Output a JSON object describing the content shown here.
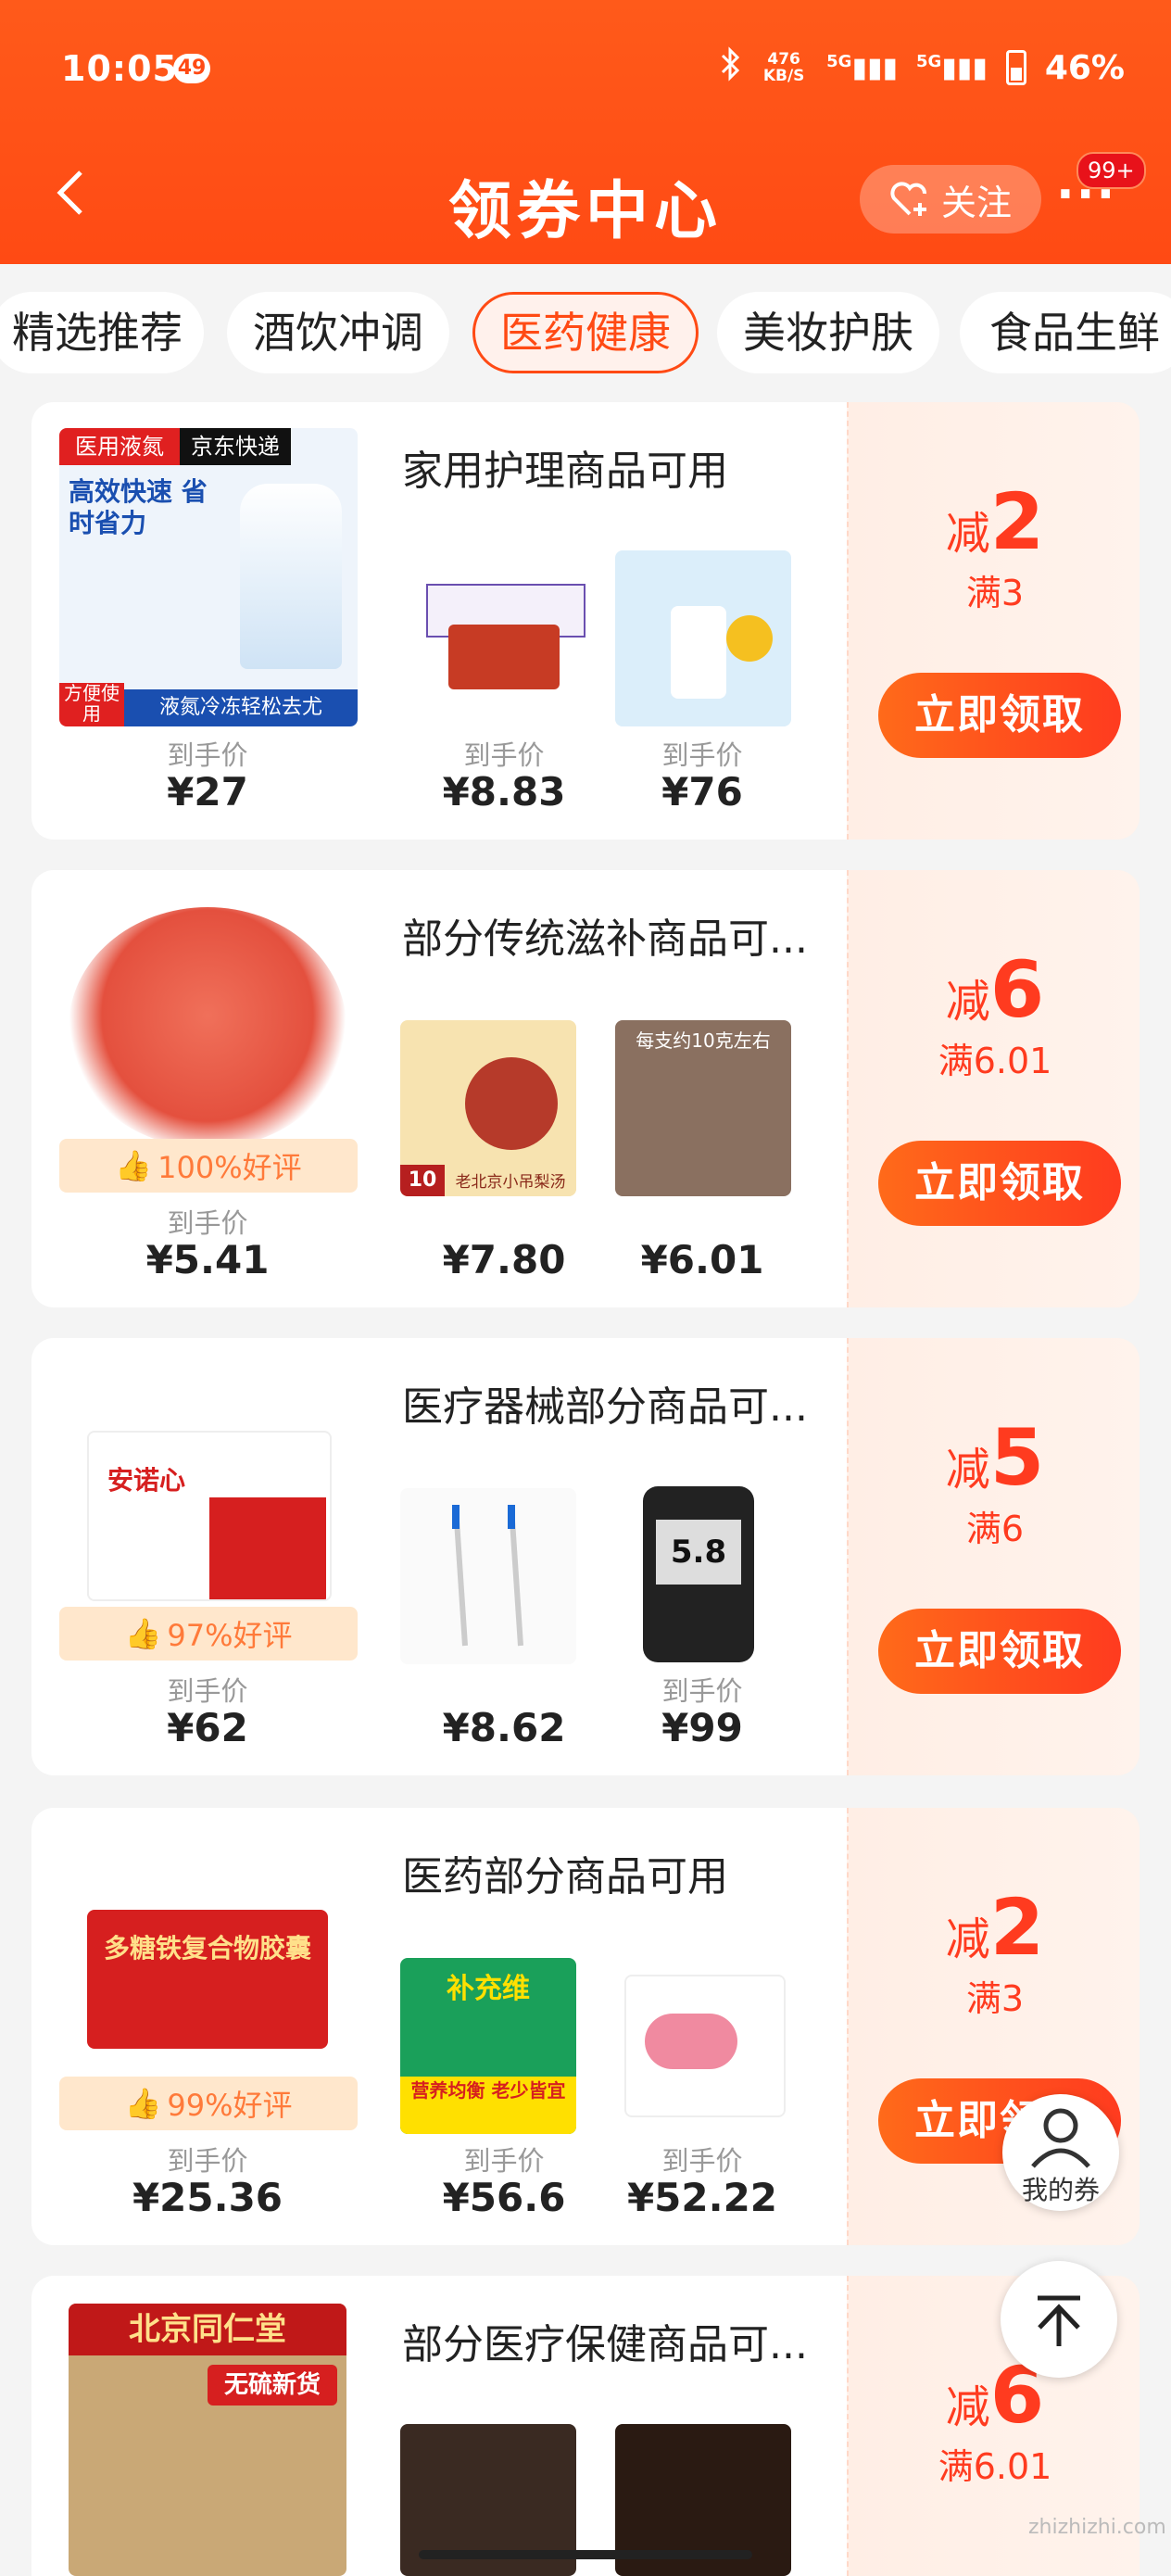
{
  "status_bar": {
    "time": "10:05",
    "notif_count": "49",
    "net_speed": "476 KB/S",
    "signal1": "5G",
    "signal2": "5G",
    "battery": "46%"
  },
  "nav": {
    "title": "领券中心",
    "follow_label": "关注",
    "more": "···",
    "msg_badge": "99+"
  },
  "tabs": [
    {
      "label": "精选推荐",
      "active": false
    },
    {
      "label": "酒饮冲调",
      "active": false
    },
    {
      "label": "医药健康",
      "active": true
    },
    {
      "label": "美妆护肤",
      "active": false
    },
    {
      "label": "食品生鲜",
      "active": false
    }
  ],
  "coupons": [
    {
      "title": "家用护理商品可用",
      "rating": "",
      "products": [
        {
          "label": "到手价",
          "price": "¥27"
        },
        {
          "label": "到手价",
          "price": "¥8.83"
        },
        {
          "label": "到手价",
          "price": "¥76"
        }
      ],
      "thumb_text": {
        "a": "医用液氮",
        "b": "京东快递",
        "c": "高效快速 省时省力",
        "d": "液氮冷冻轻松去尤",
        "e": "方便使用"
      },
      "discount_prefix": "减",
      "discount": "2",
      "condition": "满3",
      "claim": "立即领取"
    },
    {
      "title": "部分传统滋补商品可...",
      "rating": "100%好评",
      "products": [
        {
          "label": "到手价",
          "price": "¥5.41"
        },
        {
          "label": "",
          "price": "¥7.80"
        },
        {
          "label": "",
          "price": "¥6.01"
        }
      ],
      "thumb_text": {
        "a": "10包",
        "b": "老北京小吊梨汤",
        "c": "每支约10克左右"
      },
      "discount_prefix": "减",
      "discount": "6",
      "condition": "满6.01",
      "claim": "立即领取"
    },
    {
      "title": "医疗器械部分商品可...",
      "rating": "97%好评",
      "products": [
        {
          "label": "到手价",
          "price": "¥62"
        },
        {
          "label": "",
          "price": "¥8.62"
        },
        {
          "label": "到手价",
          "price": "¥99"
        }
      ],
      "thumb_text": {
        "a": "安诺心",
        "b": "5.8"
      },
      "discount_prefix": "减",
      "discount": "5",
      "condition": "满6",
      "claim": "立即领取"
    },
    {
      "title": "医药部分商品可用",
      "rating": "99%好评",
      "products": [
        {
          "label": "到手价",
          "price": "¥25.36"
        },
        {
          "label": "到手价",
          "price": "¥56.6"
        },
        {
          "label": "到手价",
          "price": "¥52.22"
        }
      ],
      "thumb_text": {
        "a": "多糖铁复合物胶囊",
        "b": "补充维",
        "c": "营养均衡 老少皆宜"
      },
      "discount_prefix": "减",
      "discount": "2",
      "condition": "满3",
      "claim": "立即领取"
    },
    {
      "title": "部分医疗保健商品可...",
      "rating": "",
      "products": [],
      "thumb_text": {
        "a": "北京同仁堂",
        "b": "无硫新货"
      },
      "discount_prefix": "减",
      "discount": "6",
      "condition": "满6.01",
      "claim": ""
    }
  ],
  "fab": {
    "mine_label": "我的券"
  },
  "watermark": "zhizhizhi.com",
  "colors": {
    "brand": "#ff4a14",
    "price_red": "#ff3b1f"
  }
}
